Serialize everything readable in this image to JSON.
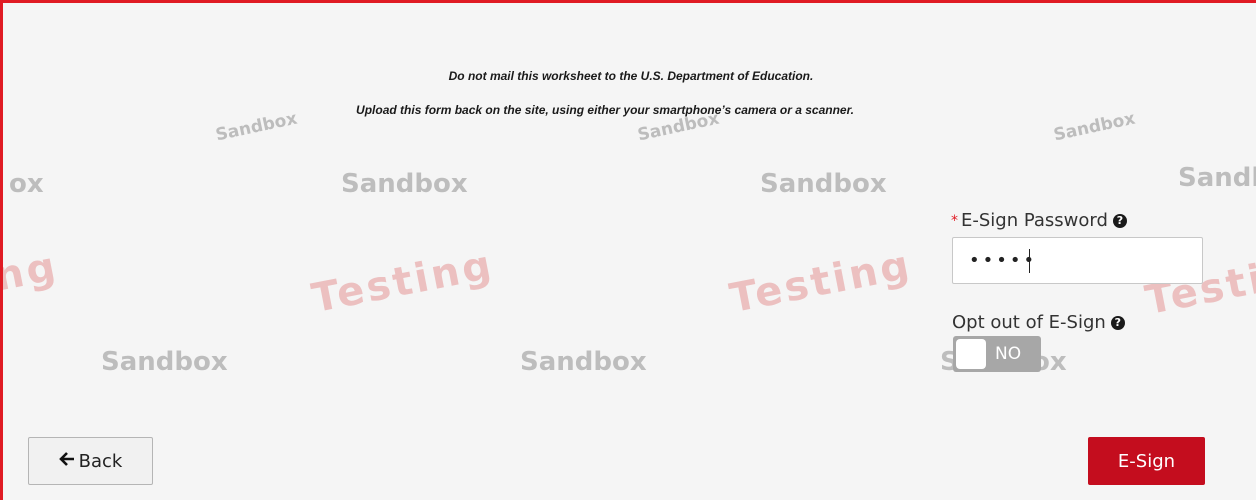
{
  "notices": {
    "line1": "Do not mail this worksheet to the U.S. Department of Education.",
    "line2": "Upload this form back on the site, using either your smartphone’s camera or a scanner."
  },
  "watermarks": {
    "sandbox": "Sandbox",
    "sandbox_small": "Sandbox",
    "testing": "Testing",
    "sandbox_fragment_left": "ox",
    "testing_fragment_left": "ng",
    "sandbox_fragment_right": "Sandb",
    "testing_fragment_right": "Testi"
  },
  "form": {
    "password_required_mark": "*",
    "password_label": "E-Sign Password",
    "password_value": "•••••",
    "help_icon": "?",
    "opt_out_label": "Opt out of E-Sign",
    "toggle_state": "NO"
  },
  "buttons": {
    "back_arrow": "🡐",
    "back_label": "Back",
    "esign_label": "E-Sign"
  },
  "colors": {
    "frame_border": "#e01b24",
    "primary_button": "#c40d1e",
    "toggle_off": "#a7a7a7"
  }
}
